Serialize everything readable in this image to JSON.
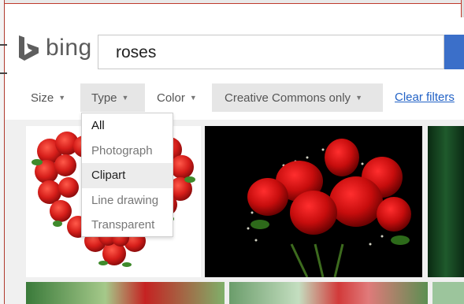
{
  "logo": {
    "text": "bing"
  },
  "search": {
    "value": "roses"
  },
  "filters": {
    "size": "Size",
    "type": "Type",
    "color": "Color",
    "license": "Creative Commons only",
    "clear": "Clear filters"
  },
  "type_menu": {
    "items": [
      "All",
      "Photograph",
      "Clipart",
      "Line drawing",
      "Transparent"
    ],
    "highlighted": "Clipart"
  },
  "colors": {
    "accent": "#3b6fc9",
    "link": "#2262c6"
  }
}
